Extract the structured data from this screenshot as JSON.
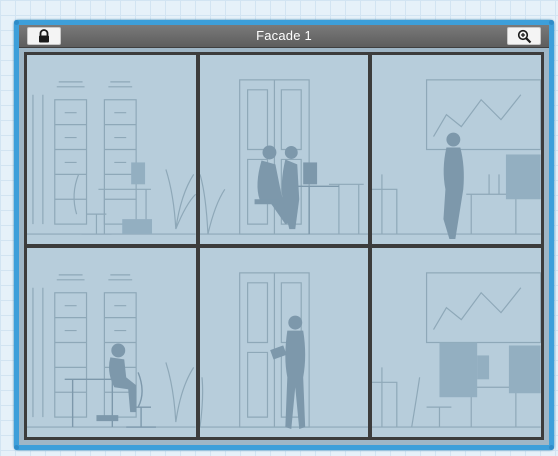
{
  "window": {
    "title": "Facade 1",
    "lock_button_icon": "lock-icon",
    "zoom_button_icon": "zoom-in-icon",
    "accent_color": "#3d9fda"
  },
  "grid": {
    "rows": 2,
    "columns": 3,
    "cells": [
      {
        "scene": "filing-cabinets-desk-monitor"
      },
      {
        "scene": "two-people-at-desk"
      },
      {
        "scene": "person-standing-whiteboard"
      },
      {
        "scene": "person-seated-at-desk-cabinets"
      },
      {
        "scene": "person-reading-near-door"
      },
      {
        "scene": "empty-office-chairs-whiteboard"
      }
    ]
  }
}
